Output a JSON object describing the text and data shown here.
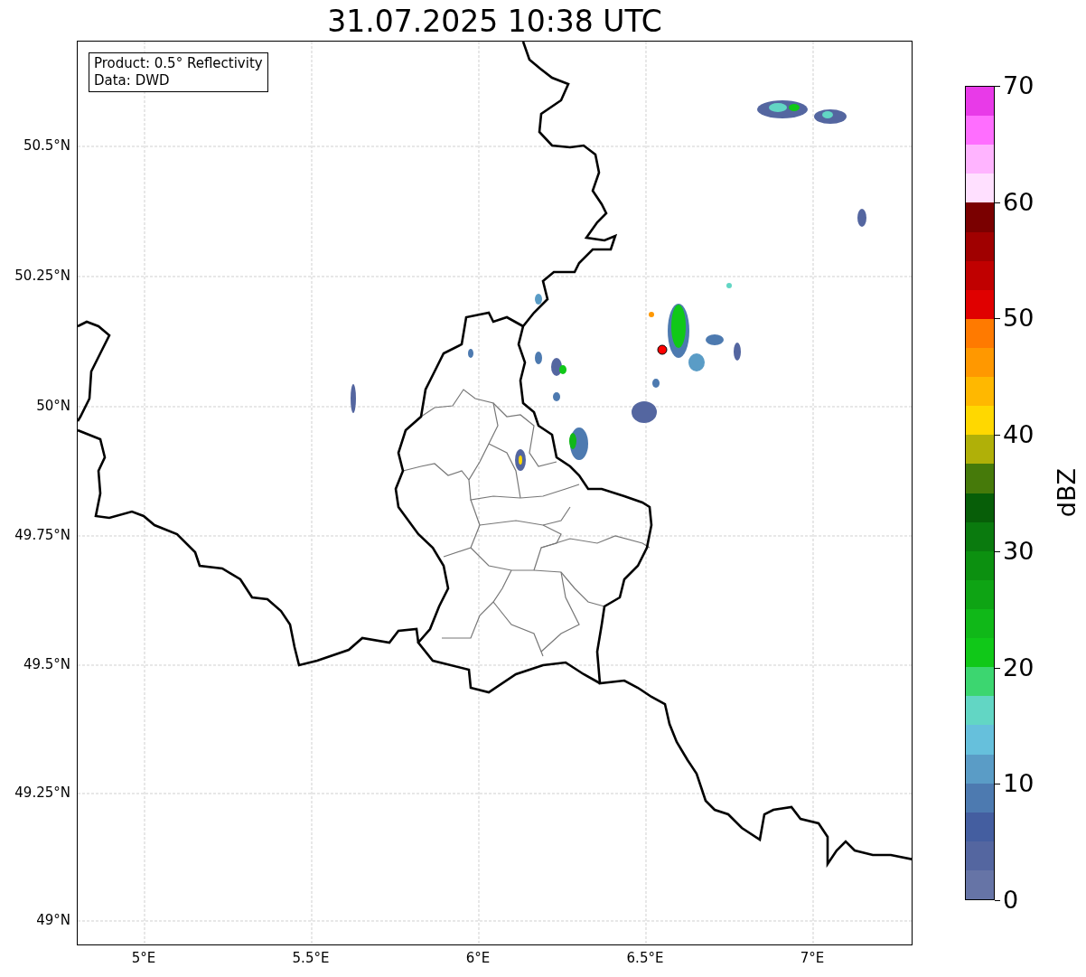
{
  "title": "31.07.2025 10:38 UTC",
  "legend": [
    "Product: 0.5° Reflectivity",
    "Data: DWD"
  ],
  "map": {
    "yticks": [
      "50.5°N",
      "50.25°N",
      "50°N",
      "49.75°N",
      "49.5°N",
      "49.25°N",
      "49°N"
    ],
    "xticks": [
      "5°E",
      "5.5°E",
      "6°E",
      "6.5°E",
      "7°E"
    ]
  },
  "colorbar": {
    "label": "dBZ",
    "ticks": [
      "70",
      "60",
      "50",
      "40",
      "30",
      "20",
      "10",
      "0"
    ],
    "bins": [
      {
        "color": "#e83ae8"
      },
      {
        "color": "#ff6eff"
      },
      {
        "color": "#ffb4ff"
      },
      {
        "color": "#ffe0ff"
      },
      {
        "color": "#7a0000"
      },
      {
        "color": "#a00000"
      },
      {
        "color": "#c00000"
      },
      {
        "color": "#e00000"
      },
      {
        "color": "#ff7a00"
      },
      {
        "color": "#ff9800"
      },
      {
        "color": "#ffb800"
      },
      {
        "color": "#ffd800"
      },
      {
        "color": "#b0b008"
      },
      {
        "color": "#467a0a"
      },
      {
        "color": "#075e08"
      },
      {
        "color": "#0a7a0e"
      },
      {
        "color": "#0c9010"
      },
      {
        "color": "#0ea414"
      },
      {
        "color": "#10b818"
      },
      {
        "color": "#10c818"
      },
      {
        "color": "#3cd670"
      },
      {
        "color": "#62d6c4"
      },
      {
        "color": "#66c0dc"
      },
      {
        "color": "#5a9cc6"
      },
      {
        "color": "#4d7ab0"
      },
      {
        "color": "#445ea0"
      },
      {
        "color": "#5466a0"
      },
      {
        "color": "#6674a6"
      }
    ]
  }
}
